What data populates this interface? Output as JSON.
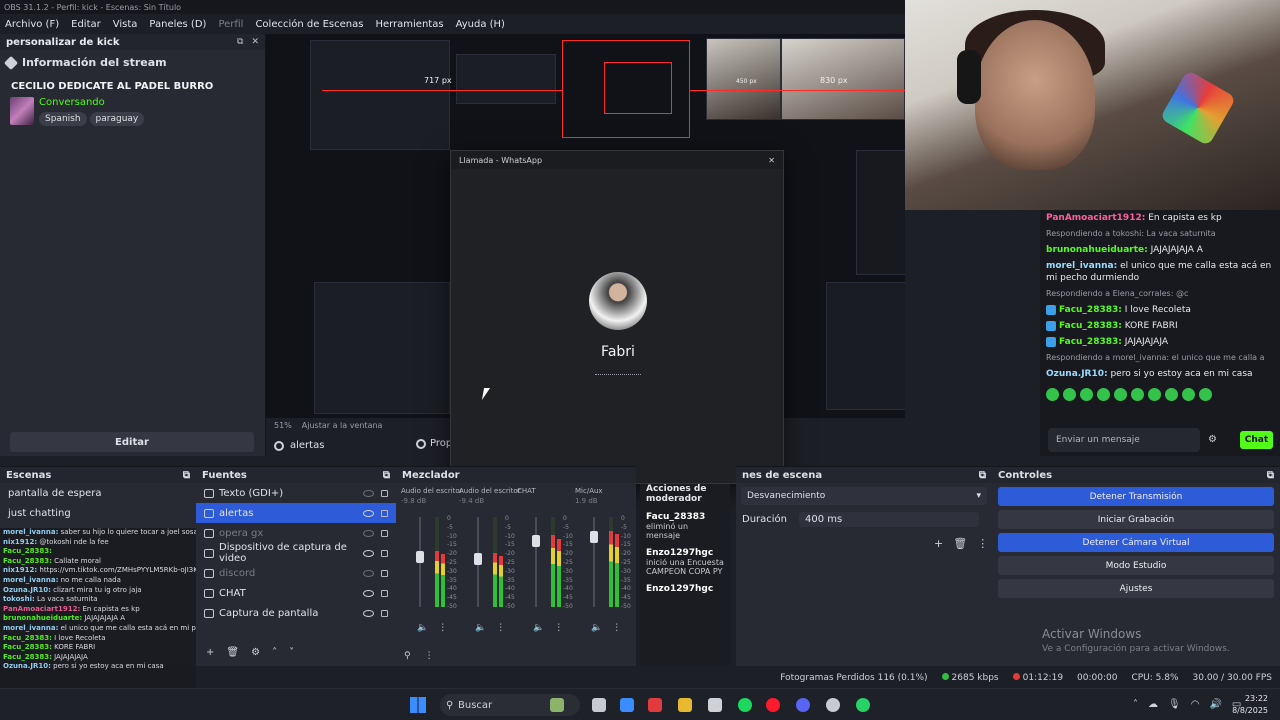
{
  "window": {
    "title": "OBS 31.1.2 - Perfil: kick - Escenas: Sin Título"
  },
  "menu": [
    {
      "label": "Archivo (F)",
      "dim": false
    },
    {
      "label": "Editar",
      "dim": false
    },
    {
      "label": "Vista",
      "dim": false
    },
    {
      "label": "Paneles (D)",
      "dim": false
    },
    {
      "label": "Perfil",
      "dim": true
    },
    {
      "label": "Colección de Escenas",
      "dim": false
    },
    {
      "label": "Herramientas",
      "dim": false
    },
    {
      "label": "Ayuda (H)",
      "dim": false
    }
  ],
  "streaminfo": {
    "dock_title": "personalizar de kick",
    "section": "Información del stream",
    "channel": "CECILIO DEDICATE AL PADEL BURRO",
    "category": "Conversando",
    "tags": [
      "Spanish",
      "paraguay"
    ],
    "edit": "Editar"
  },
  "preview": {
    "px1": "717 px",
    "px2": "830 px",
    "px3": "450 px",
    "zoom": "51%",
    "fit": "Ajustar a la ventana",
    "selected_source": "alertas",
    "props": "Prop"
  },
  "whatsapp": {
    "title": "Llamada - WhatsApp",
    "caller": "Fabri"
  },
  "chat": {
    "messages": [
      {
        "type": "msg",
        "user": "PanAmoaciart1912:",
        "text": " En capista es kp",
        "color": "#ff5f9e"
      },
      {
        "type": "reply",
        "text": "Respondiendo a tokoshi: La vaca saturnita"
      },
      {
        "type": "msg",
        "user": "brunonahueiduarte:",
        "text": " JAJAJAJAJA A",
        "color": "#53fc18"
      },
      {
        "type": "msg",
        "user": "morel_ivanna:",
        "text": " el unico que me calla esta acá en mi pecho durmiendo",
        "color": "#9adcff"
      },
      {
        "type": "reply",
        "text": "Respondiendo a Elena_corrales: @c"
      },
      {
        "type": "msg",
        "user": "Facu_28383:",
        "text": " I love Recoleta",
        "color": "#53fc18",
        "badge": true
      },
      {
        "type": "msg",
        "user": "Facu_28383:",
        "text": " KORE FABRI",
        "color": "#53fc18",
        "badge": true
      },
      {
        "type": "msg",
        "user": "Facu_28383:",
        "text": " JAJAJAJAJA",
        "color": "#53fc18",
        "badge": true
      },
      {
        "type": "reply",
        "text": "Respondiendo a morel_ivanna: el unico que me calla a"
      },
      {
        "type": "msg",
        "user": "Ozuna.JR10:",
        "text": " pero si yo estoy aca en mi casa",
        "color": "#9adcff"
      }
    ],
    "input_placeholder": "Enviar un mensaje",
    "send": "Chat"
  },
  "scenes": {
    "title": "Escenas",
    "items": [
      "pantalla de espera",
      "just chatting"
    ]
  },
  "sources": {
    "title": "Fuentes",
    "items": [
      {
        "name": "Texto (GDI+)",
        "visible": false,
        "selected": false,
        "dim": false
      },
      {
        "name": "alertas",
        "visible": true,
        "selected": true,
        "dim": false
      },
      {
        "name": "opera gx",
        "visible": false,
        "selected": false,
        "dim": true
      },
      {
        "name": "Dispositivo de captura de video",
        "visible": true,
        "selected": false,
        "dim": false
      },
      {
        "name": "discord",
        "visible": false,
        "selected": false,
        "dim": true
      },
      {
        "name": "CHAT",
        "visible": true,
        "selected": false,
        "dim": false
      },
      {
        "name": "Captura de pantalla",
        "visible": true,
        "selected": false,
        "dim": false
      }
    ]
  },
  "mixer": {
    "title": "Mezclador",
    "channels": [
      {
        "name": "Audio del escritorio",
        "db": "-9.8 dB",
        "level": 0.62
      },
      {
        "name": "Audio del escritorio",
        "db": "-9.4 dB",
        "level": 0.6
      },
      {
        "name": "CHAT",
        "db": "",
        "level": 0.8
      },
      {
        "name": "Mic/Aux",
        "db": "1.9 dB",
        "level": 0.85
      }
    ],
    "ticks": [
      "0",
      "-5",
      "-10",
      "-15",
      "-20",
      "-25",
      "-30",
      "-35",
      "-40",
      "-45",
      "-50"
    ]
  },
  "modactions": {
    "title": "Acciones de moderador",
    "entries": [
      {
        "user": "Facu_28383",
        "text": "eliminó un mensaje"
      },
      {
        "user": "Enzo1297hgc",
        "text": "inició una Encuesta",
        "extra": "CAMPEON COPA PY"
      },
      {
        "user": "Enzo1297hgc",
        "text": ""
      }
    ]
  },
  "transitions": {
    "title": "nes de escena",
    "type": "Desvanecimiento",
    "duration_label": "Duración",
    "duration": "400 ms"
  },
  "controls": {
    "title": "Controles",
    "buttons": [
      {
        "label": "Detener Transmisión",
        "active": true
      },
      {
        "label": "Iniciar Grabación",
        "active": false
      },
      {
        "label": "Detener Cámara Virtual",
        "active": true
      },
      {
        "label": "Modo Estudio",
        "active": false
      },
      {
        "label": "Ajustes",
        "active": false
      }
    ],
    "activate_title": "Activar Windows",
    "activate_sub": "Ve a Configuración para activar Windows."
  },
  "kick_overlay": [
    {
      "u": "morel_ivanna:",
      "t": " saber su hijo lo quiere tocar a joel sosa",
      "c": ""
    },
    {
      "u": "nix1912:",
      "t": " @tokoshi nde la fee",
      "c": ""
    },
    {
      "u": "Facu_28383:",
      "t": " ",
      "c": "g"
    },
    {
      "u": "Facu_28383:",
      "t": " Callate moral",
      "c": "g"
    },
    {
      "u": "nix1912:",
      "t": " https://vm.tiktok.com/ZMHsPYYLM5RKb-oJI3K/",
      "c": ""
    },
    {
      "u": "morel_ivanna:",
      "t": " no me calla nada",
      "c": ""
    },
    {
      "u": "Ozuna.JR10:",
      "t": " clizart mira tu ig otro jaja",
      "c": ""
    },
    {
      "u": "tokoshi:",
      "t": " La vaca saturnita",
      "c": ""
    },
    {
      "u": "PanAmoaciart1912:",
      "t": " En capista es kp",
      "c": "p"
    },
    {
      "u": "brunonahueiduarte:",
      "t": " JAJAJAJAJA A",
      "c": "g"
    },
    {
      "u": "morel_ivanna:",
      "t": " el unico que me calla esta acá en mi pecho durmiendo",
      "c": ""
    },
    {
      "u": "Facu_28383:",
      "t": " I love Recoleta",
      "c": "g"
    },
    {
      "u": "Facu_28383:",
      "t": " KORE FABRI",
      "c": "g"
    },
    {
      "u": "Facu_28383:",
      "t": " JAJAJAJAJA",
      "c": "g"
    },
    {
      "u": "Ozuna.JR10:",
      "t": " pero si yo estoy aca en mi casa",
      "c": ""
    }
  ],
  "status": {
    "frames": "Fotogramas Perdidos 116 (0.1%)",
    "kbps": "2685 kbps",
    "live": "01:12:19",
    "rec": "00:00:00",
    "cpu": "CPU: 5.8%",
    "fps": "30.00 / 30.00 FPS"
  },
  "taskbar": {
    "search": "Buscar",
    "time": "23:22",
    "date": "8/8/2025"
  }
}
